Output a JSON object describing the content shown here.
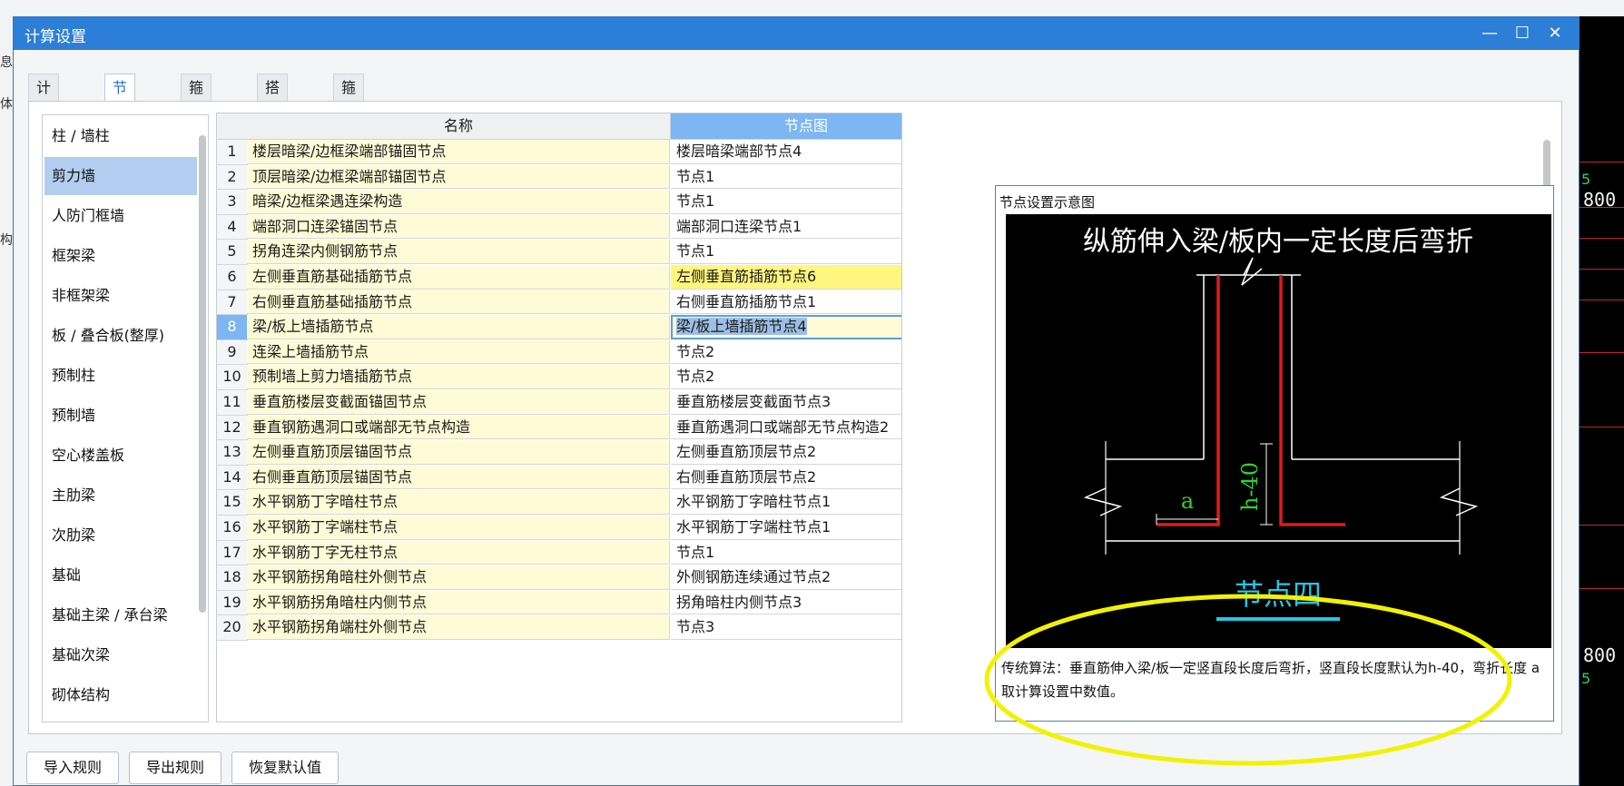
{
  "window": {
    "title": "计算设置",
    "minimize_label": "—",
    "maximize_label": "☐",
    "close_label": "✕"
  },
  "tabs": [
    {
      "label": "计算规则",
      "active": false
    },
    {
      "label": "节点设置",
      "active": true
    },
    {
      "label": "箍筋设置",
      "active": false
    },
    {
      "label": "搭接设置",
      "active": false
    },
    {
      "label": "箍筋公式",
      "active": false
    }
  ],
  "categories": [
    {
      "label": "柱 / 墙柱",
      "selected": false
    },
    {
      "label": "剪力墙",
      "selected": true
    },
    {
      "label": "人防门框墙",
      "selected": false
    },
    {
      "label": "框架梁",
      "selected": false
    },
    {
      "label": "非框架梁",
      "selected": false
    },
    {
      "label": "板 / 叠合板(整厚)",
      "selected": false
    },
    {
      "label": "预制柱",
      "selected": false
    },
    {
      "label": "预制墙",
      "selected": false
    },
    {
      "label": "空心楼盖板",
      "selected": false
    },
    {
      "label": "主肋梁",
      "selected": false
    },
    {
      "label": "次肋梁",
      "selected": false
    },
    {
      "label": "基础",
      "selected": false
    },
    {
      "label": "基础主梁 / 承台梁",
      "selected": false
    },
    {
      "label": "基础次梁",
      "selected": false
    },
    {
      "label": "砌体结构",
      "selected": false
    }
  ],
  "grid": {
    "col_name": "名称",
    "col_node": "节点图",
    "ellipsis_label": "···",
    "rows": [
      {
        "index": "1",
        "name": "楼层暗梁/边框梁端部锚固节点",
        "node": "楼层暗梁端部节点4"
      },
      {
        "index": "2",
        "name": "顶层暗梁/边框梁端部锚固节点",
        "node": "节点1"
      },
      {
        "index": "3",
        "name": "暗梁/边框梁遇连梁构造",
        "node": "节点1"
      },
      {
        "index": "4",
        "name": "端部洞口连梁锚固节点",
        "node": "端部洞口连梁节点1"
      },
      {
        "index": "5",
        "name": "拐角连梁内侧钢筋节点",
        "node": "节点1"
      },
      {
        "index": "6",
        "name": "左侧垂直筋基础插筋节点",
        "node": "左侧垂直筋插筋节点6"
      },
      {
        "index": "7",
        "name": "右侧垂直筋基础插筋节点",
        "node": "右侧垂直筋插筋节点1"
      },
      {
        "index": "8",
        "name": "梁/板上墙插筋节点",
        "node": "梁/板上墙插筋节点4"
      },
      {
        "index": "9",
        "name": "连梁上墙插筋节点",
        "node": "节点2"
      },
      {
        "index": "10",
        "name": "预制墙上剪力墙插筋节点",
        "node": "节点2"
      },
      {
        "index": "11",
        "name": "垂直筋楼层变截面锚固节点",
        "node": "垂直筋楼层变截面节点3"
      },
      {
        "index": "12",
        "name": "垂直钢筋遇洞口或端部无节点构造",
        "node": "垂直筋遇洞口或端部无节点构造2"
      },
      {
        "index": "13",
        "name": "左侧垂直筋顶层锚固节点",
        "node": "左侧垂直筋顶层节点2"
      },
      {
        "index": "14",
        "name": "右侧垂直筋顶层锚固节点",
        "node": "右侧垂直筋顶层节点2"
      },
      {
        "index": "15",
        "name": "水平钢筋丁字暗柱节点",
        "node": "水平钢筋丁字暗柱节点1"
      },
      {
        "index": "16",
        "name": "水平钢筋丁字端柱节点",
        "node": "水平钢筋丁字端柱节点1"
      },
      {
        "index": "17",
        "name": "水平钢筋丁字无柱节点",
        "node": "节点1"
      },
      {
        "index": "18",
        "name": "水平钢筋拐角暗柱外侧节点",
        "node": "外侧钢筋连续通过节点2"
      },
      {
        "index": "19",
        "name": "水平钢筋拐角暗柱内侧节点",
        "node": "拐角暗柱内侧节点3"
      },
      {
        "index": "20",
        "name": "水平钢筋拐角端柱外侧节点",
        "node": "节点3"
      }
    ]
  },
  "preview": {
    "title": "节点设置示意图",
    "diagram_heading": "纵筋伸入梁/板内一定长度后弯折",
    "label_a": "a",
    "label_h": "h-40",
    "node_caption": "节点四",
    "description": "传统算法：垂直筋伸入梁/板一定竖直段长度后弯折，竖直段长度默认为h-40，弯折长度 a 取计算设置中数值。"
  },
  "buttons": {
    "import": "导入规则",
    "export": "导出规则",
    "restore": "恢复默认值"
  },
  "background": {
    "left_glyphs": [
      "息",
      "体",
      "构"
    ],
    "cad_texts": [
      "800",
      "800"
    ],
    "cad_dims": [
      "5",
      "5"
    ]
  },
  "colors": {
    "title_bar": "#2d7ed6",
    "selected_category": "#b3cdf0",
    "header_node": "#7db6f2",
    "name_cell": "#fffbd6",
    "highlight_cell": "#fff67f",
    "annotation_ellipse": "#f2f200",
    "diagram_rebar": "#e01b1b",
    "diagram_label": "#2bd42b",
    "diagram_caption": "#22c6e6"
  }
}
